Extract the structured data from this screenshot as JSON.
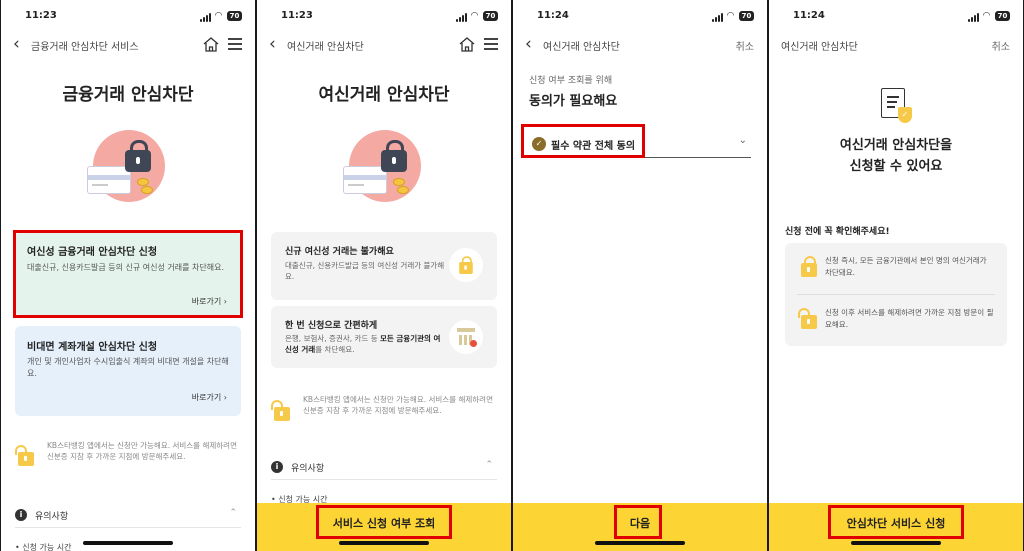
{
  "screen1": {
    "status": {
      "time": "11:23",
      "battery": "70"
    },
    "nav": {
      "title": "금융거래 안심차단 서비스"
    },
    "heading": "금융거래 안심차단",
    "card1": {
      "title": "여신성 금융거래 안심차단 신청",
      "desc": "대출신규, 신용카드발급 등의 신규 여신성 거래를 차단해요.",
      "link": "바로가기"
    },
    "card2": {
      "title": "비대면 계좌개설 안심차단 신청",
      "desc": "개인 및 개인사업자 수시입출식 계좌의 비대면 개설을 차단해요.",
      "link": "바로가기"
    },
    "note": "KB스타뱅킹 앱에서는 신청만 가능해요. 서비스를 해제하려면 신분증 지참 후 가까운 지점에 방문해주세요.",
    "caution_label": "유의사항",
    "bullet": "• 신청 가능 시간"
  },
  "screen2": {
    "status": {
      "time": "11:23",
      "battery": "70"
    },
    "nav": {
      "title": "여신거래 안심차단"
    },
    "heading": "여신거래 안심차단",
    "card1": {
      "title": "신규 여신성 거래는 불가해요",
      "desc": "대출신규, 신용카드발급 등의 여신성 거래가 불가해요."
    },
    "card2": {
      "title": "한 번 신청으로 간편하게",
      "desc_pre": "은행, 보험사, 증권사, 카드 등 ",
      "desc_bold": "모든 금융기관의 여신성 거래",
      "desc_post": "를 차단해요."
    },
    "note": "KB스타뱅킹 앱에서는 신청만 가능해요. 서비스를 해제하려면 신분증 지참 후 가까운 지점에 방문해주세요.",
    "caution_label": "유의사항",
    "bullet": "• 신청 가능 시간",
    "button": "서비스 신청 여부 조회"
  },
  "screen3": {
    "status": {
      "time": "11:24",
      "battery": "70"
    },
    "nav": {
      "title": "여신거래 안심차단",
      "cancel": "취소"
    },
    "sub": "신청 여부 조회를 위해",
    "heading": "동의가 필요해요",
    "agree": "필수 약관 전체 동의",
    "button": "다음"
  },
  "screen4": {
    "status": {
      "time": "11:24",
      "battery": "70"
    },
    "nav": {
      "title": "여신거래 안심차단",
      "cancel": "취소"
    },
    "title_line1": "여신거래 안심차단을",
    "title_line2": "신청할 수 있어요",
    "check_label": "신청 전에 꼭 확인해주세요!",
    "row1": "신청 즉시, 모든 금융기관에서 본인 명의 여신거래가 차단돼요.",
    "row2": "신청 이후 서비스를 해제하려면 가까운 지점 방문이 필요해요.",
    "button": "안심차단 서비스 신청"
  },
  "colors": {
    "accent_yellow": "#fcd433",
    "highlight_red": "#e10000",
    "card_green": "#e4f4ec",
    "card_blue": "#e5f0fb"
  },
  "icons": [
    "back-chevron-icon",
    "home-icon",
    "hamburger-menu-icon",
    "lock-icon",
    "coin-icon",
    "padlock-icon",
    "info-icon",
    "chevron-up-icon",
    "chevron-down-icon",
    "check-circle-icon",
    "document-shield-icon",
    "bank-icon"
  ]
}
